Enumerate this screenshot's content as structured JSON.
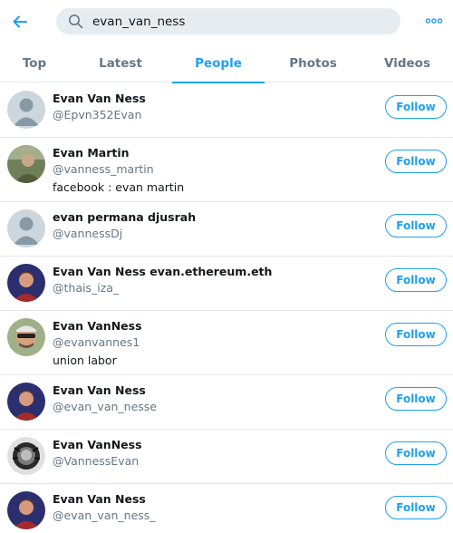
{
  "search": {
    "query": "evan_van_ness"
  },
  "icons": {
    "back": "arrow-left-icon",
    "search": "search-icon",
    "more": "more-dots-icon"
  },
  "colors": {
    "accent": "#1da1f2",
    "secondary_text": "#657786",
    "border": "#e1e8ed",
    "search_bg": "#e6ecf0"
  },
  "tabs": [
    {
      "label": "Top",
      "active": false
    },
    {
      "label": "Latest",
      "active": false
    },
    {
      "label": "People",
      "active": true
    },
    {
      "label": "Photos",
      "active": false
    },
    {
      "label": "Videos",
      "active": false
    }
  ],
  "people": [
    {
      "name": "Evan Van Ness",
      "handle": "@Epvn352Evan",
      "bio": "",
      "follow_label": "Follow"
    },
    {
      "name": "Evan Martin",
      "handle": "@vanness_martin",
      "bio": "facebook : evan martin",
      "follow_label": "Follow"
    },
    {
      "name": "evan permana djusrah",
      "handle": "@vannessDj",
      "bio": "",
      "follow_label": "Follow"
    },
    {
      "name": "Evan Van Ness evan.ethereum.eth",
      "handle": "@thais_iza_",
      "bio": "",
      "follow_label": "Follow"
    },
    {
      "name": "Evan VanNess",
      "handle": "@evanvannes1",
      "bio": "union labor",
      "follow_label": "Follow"
    },
    {
      "name": "Evan Van Ness",
      "handle": "@evan_van_nesse",
      "bio": "",
      "follow_label": "Follow"
    },
    {
      "name": "Evan VanNess",
      "handle": "@VannessEvan",
      "bio": "",
      "follow_label": "Follow"
    },
    {
      "name": "Evan Van Ness",
      "handle": "@evan_van_ness_",
      "bio": "",
      "follow_label": "Follow"
    }
  ]
}
